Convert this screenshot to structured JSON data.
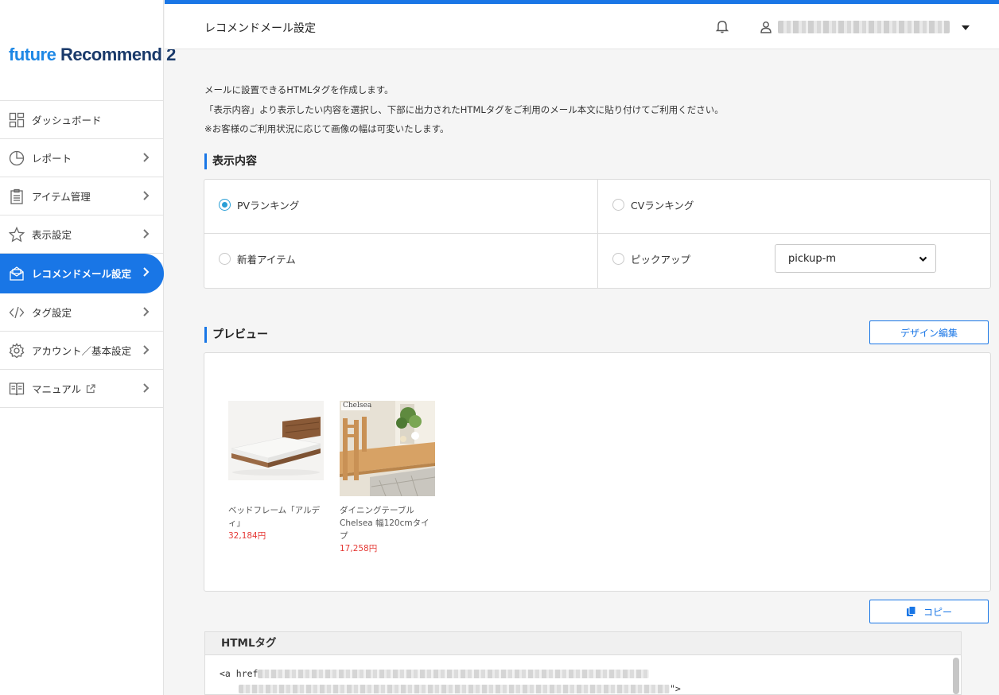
{
  "app": {
    "logo_part1": "future",
    "logo_part2": " Recommend 2"
  },
  "sidebar": {
    "items": [
      {
        "label": "ダッシュボード",
        "icon": "dashboard-icon",
        "chevron": false
      },
      {
        "label": "レポート",
        "icon": "pie-chart-icon",
        "chevron": true
      },
      {
        "label": "アイテム管理",
        "icon": "clipboard-icon",
        "chevron": true
      },
      {
        "label": "表示設定",
        "icon": "star-icon",
        "chevron": true
      },
      {
        "label": "レコメンドメール設定",
        "icon": "mail-icon",
        "chevron": true,
        "active": true
      },
      {
        "label": "タグ設定",
        "icon": "code-icon",
        "chevron": true
      },
      {
        "label": "アカウント／基本設定",
        "icon": "gear-icon",
        "chevron": true
      },
      {
        "label": "マニュアル",
        "icon": "book-icon",
        "chevron": true,
        "external": true
      }
    ]
  },
  "header": {
    "title": "レコメンドメール設定"
  },
  "intro": {
    "line1": "メールに設置できるHTMLタグを作成します。",
    "line2": "「表示内容」より表示したい内容を選択し、下部に出力されたHTMLタグをご利用のメール本文に貼り付けてご利用ください。",
    "line3": "※お客様のご利用状況に応じて画像の幅は可変いたします。"
  },
  "display": {
    "title": "表示内容",
    "options": {
      "pv": "PVランキング",
      "cv": "CVランキング",
      "new": "新着アイテム",
      "pickup": "ピックアップ"
    },
    "selected": "PVランキング",
    "pickup_select_value": "pickup-m"
  },
  "preview": {
    "title": "プレビュー",
    "design_button": "デザイン編集",
    "products": [
      {
        "name": "ベッドフレーム「アルディ」",
        "price": "32,184円"
      },
      {
        "name": "ダイニングテーブル Chelsea 幅120cmタイプ",
        "price": "17,258円",
        "image_label": "Chelsea"
      }
    ]
  },
  "copy_button": "コピー",
  "html_tag": {
    "title": "HTMLタグ",
    "line1_prefix": "<a href",
    "line2_prefix": "  <img src=\"https://staging-g.ed-remd.net/img/fs.pangha_test/pc/ranking/pv/week/",
    "line2_suffix": "\">"
  },
  "colors": {
    "accent": "#1976e6",
    "radio": "#2a9fd6",
    "price": "#e53935"
  }
}
